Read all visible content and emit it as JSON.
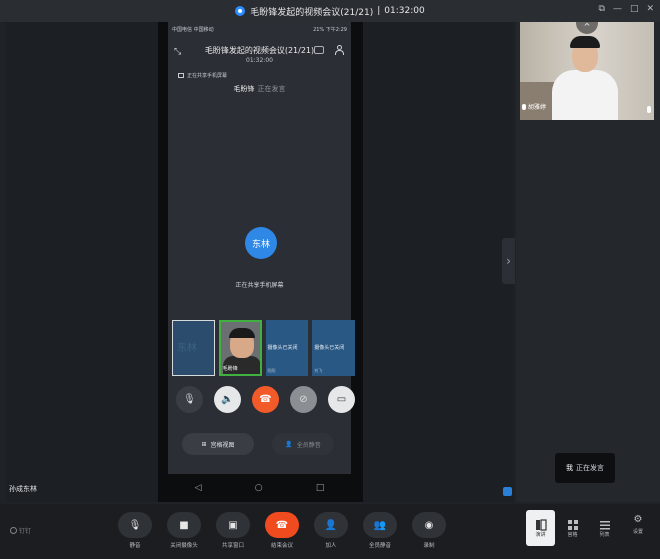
{
  "window": {
    "title": "毛盼锋发起的视频会议(21/21)",
    "separator": "|",
    "duration": "01:32:00",
    "controls": [
      "⧉",
      "—",
      "□",
      "✕"
    ]
  },
  "phone": {
    "status_left": "中国电信\n中国移动",
    "status_right": "21% 下午2:29",
    "meeting_title": "毛盼锋发起的视频会议(21/21)",
    "meeting_time": "01:32:00",
    "share_note": "正在共享手机屏幕",
    "speaker_name": "毛盼锋",
    "speaker_status": "正在发言",
    "avatar_text": "东林",
    "sharing_label": "正在共享手机屏幕",
    "tiles": [
      {
        "big": "东林",
        "name": ""
      },
      {
        "name": "毛盼锋"
      },
      {
        "status": "摄像头已关闭",
        "sub": "阳阳"
      },
      {
        "status": "摄像头已关闭",
        "sub": "刘飞"
      }
    ],
    "grid_view_label": "宫格视图",
    "mute_all_label": "全员静音"
  },
  "local_name": "孙成东林",
  "remote": {
    "name": "胡雅婷"
  },
  "speaking_toast": {
    "me": "我",
    "status": "正在发言"
  },
  "toolbar": {
    "brand": "钉钉",
    "items": [
      {
        "label": "静音",
        "icon": "mic-icon"
      },
      {
        "label": "关闭摄像头",
        "icon": "camera-icon"
      },
      {
        "label": "共享窗口",
        "icon": "share-icon"
      },
      {
        "label": "结束会议",
        "icon": "hangup-icon"
      },
      {
        "label": "加人",
        "icon": "add-person-icon"
      },
      {
        "label": "全员静音",
        "icon": "mute-all-icon"
      },
      {
        "label": "录制",
        "icon": "record-icon"
      }
    ],
    "views": [
      {
        "label": "演讲"
      },
      {
        "label": "宫格"
      },
      {
        "label": "列表"
      }
    ],
    "settings_label": "设置"
  },
  "colors": {
    "accent": "#2f87e6",
    "hangup": "#f04b1f",
    "active_border": "#40b040"
  }
}
